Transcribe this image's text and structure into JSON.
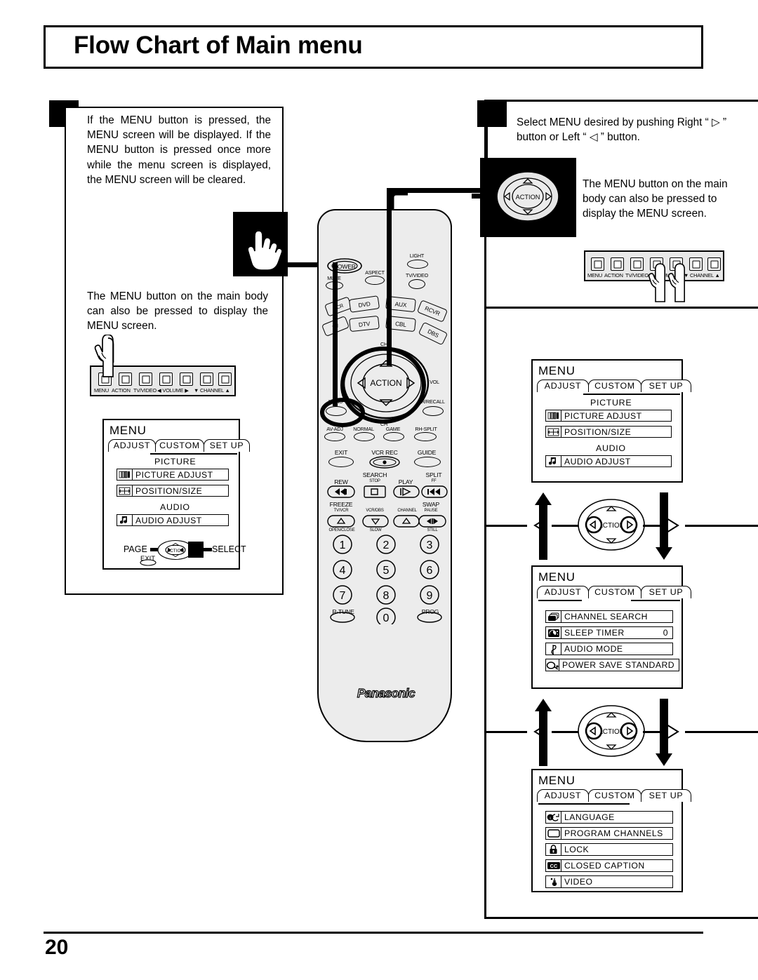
{
  "page": {
    "title": "Flow Chart of Main menu",
    "number": "20"
  },
  "left": {
    "para1": "If the MENU button is pressed, the MENU screen will be displayed. If the MENU button is pressed once more while the menu screen is displayed, the MENU screen will be cleared.",
    "para2": "The MENU button on the main body can also be pressed to display the MENU screen."
  },
  "right": {
    "para1": "Select MENU desired by pushing Right “ ▷ ” button or Left “ ◁ ” button.",
    "para2": "The MENU button on the main body can also be pressed to display the MENU screen."
  },
  "control_bar": {
    "buttons": [
      {
        "label": "MENU",
        "icon": "square-button-icon"
      },
      {
        "label": "ACTION",
        "icon": "square-button-icon"
      },
      {
        "label": "TV/VIDEO",
        "icon": "square-button-icon"
      },
      {
        "label": "◀ VOLUME ▶",
        "icon": "square-button-icon"
      },
      {
        "label": "▼ CHANNEL ▲",
        "icon": "square-button-icon"
      }
    ],
    "labels": [
      "MENU",
      "ACTION",
      "TV/VIDEO",
      "◀ VOLUME ▶",
      "▼ CHANNEL ▲"
    ]
  },
  "osd": {
    "title": "MENU",
    "tabs": [
      "ADJUST",
      "CUSTOM",
      "SET  UP"
    ],
    "footer": {
      "page": "PAGE",
      "action": "ACTION",
      "select": "SELECT",
      "exit": "EXIT"
    },
    "adjust": {
      "group1": "PICTURE",
      "group2": "AUDIO",
      "items_picture": [
        {
          "label": "PICTURE  ADJUST",
          "value": "",
          "icon": "picture-bars-icon"
        },
        {
          "label": "POSITION/SIZE",
          "value": "",
          "icon": "position-size-icon"
        }
      ],
      "items_audio": [
        {
          "label": "AUDIO  ADJUST",
          "value": "",
          "icon": "music-note-icon"
        }
      ]
    },
    "custom": {
      "items": [
        {
          "label": "CHANNEL  SEARCH",
          "value": "",
          "icon": "stacked-screens-icon"
        },
        {
          "label": "SLEEP  TIMER",
          "value": "0",
          "icon": "sleep-timer-icon"
        },
        {
          "label": "AUDIO  MODE",
          "value": "",
          "icon": "treble-clef-icon"
        },
        {
          "label": "POWER SAVE    STANDARD",
          "value": "",
          "icon": "power-save-icon"
        }
      ]
    },
    "setup": {
      "items": [
        {
          "label": "LANGUAGE",
          "value": "",
          "icon": "language-icon"
        },
        {
          "label": "PROGRAM  CHANNELS",
          "value": "",
          "icon": "screen-icon"
        },
        {
          "label": "LOCK",
          "value": "",
          "icon": "padlock-icon"
        },
        {
          "label": "CLOSED  CAPTION",
          "value": "",
          "icon": "cc-icon"
        },
        {
          "label": "VIDEO",
          "value": "",
          "icon": "video-jack-icon"
        }
      ]
    }
  },
  "remote": {
    "brand": "Panasonic",
    "power": "POWER",
    "mute": "MUTE",
    "aspect": "ASPECT",
    "light": "LIGHT",
    "tvvideo": "TV/VIDEO",
    "device_buttons": [
      "VCR",
      "DVD",
      "AUX",
      "TV",
      "DTV",
      "CBL",
      "RCVR",
      "DBS"
    ],
    "ch_up": "CH",
    "ch_dn": "CH",
    "vol": "VOL",
    "action": "ACTION",
    "menu": "MENU",
    "recall": "R/RECALL",
    "fn_row": [
      "AV-ADJ",
      "NORMAL",
      "GAME",
      "RH-SPLIT"
    ],
    "exit": "EXIT",
    "vcr_rec": "VCR REC",
    "guide": "GUIDE",
    "transport": [
      {
        "top": "",
        "main": "REW",
        "sub": ""
      },
      {
        "top": "SEARCH",
        "main": "STOP",
        "sub": ""
      },
      {
        "top": "",
        "main": "PLAY",
        "sub": ""
      },
      {
        "top": "SPLIT",
        "main": "FF",
        "sub": ""
      }
    ],
    "transport2": [
      {
        "top": "FREEZE",
        "main": "TV/VCR",
        "sub": "OPEN/CLOSE"
      },
      {
        "top": "",
        "main": "VCR/DBS",
        "sub": "SLOW"
      },
      {
        "top": "",
        "main": "CHANNEL",
        "sub": ""
      },
      {
        "top": "SWAP",
        "main": "PAUSE",
        "sub": "STILL"
      }
    ],
    "keypad": [
      "1",
      "2",
      "3",
      "4",
      "5",
      "6",
      "7",
      "8",
      "9",
      "0"
    ],
    "r_tune": "R-TUNE",
    "prog": "PROG"
  },
  "flow": {
    "action_label": "ACTION",
    "left_arrow": "◁",
    "right_arrow": "▷"
  },
  "colors": {
    "ink": "#000000",
    "panel": "#ececec",
    "bar": "#e8e8e8"
  }
}
